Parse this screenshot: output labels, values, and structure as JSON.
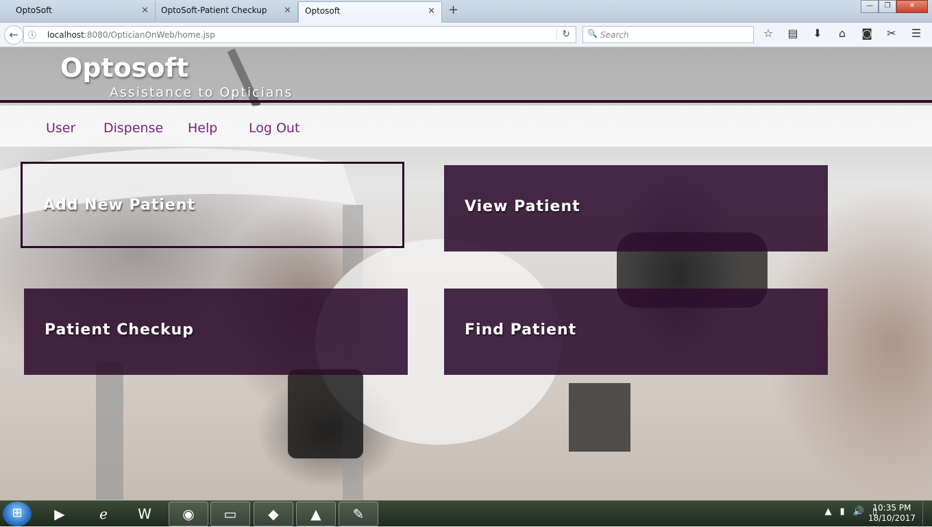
{
  "browser": {
    "tabs": [
      {
        "title": "OptoSoft",
        "active": false
      },
      {
        "title": "OptoSoft-Patient Checkup",
        "active": false
      },
      {
        "title": "Optosoft",
        "active": true
      }
    ],
    "url_host": "localhost",
    "url_rest": ":8080/OpticianOnWeb/home.jsp",
    "search_placeholder": "Search"
  },
  "header": {
    "brand": "Optosoft",
    "tagline": "Assistance to Opticians"
  },
  "menu": {
    "items": [
      "User",
      "Dispense",
      "Help",
      "Log Out"
    ]
  },
  "tiles": {
    "add_new_patient": "Add New Patient",
    "view_patient": "View Patient",
    "patient_checkup": "Patient Checkup",
    "find_patient": "Find Patient"
  },
  "taskbar": {
    "time": "10:35 PM",
    "date": "18/10/2017"
  },
  "colors": {
    "brand_purple": "#2e0d2e",
    "menu_link": "#7a1f7a"
  }
}
